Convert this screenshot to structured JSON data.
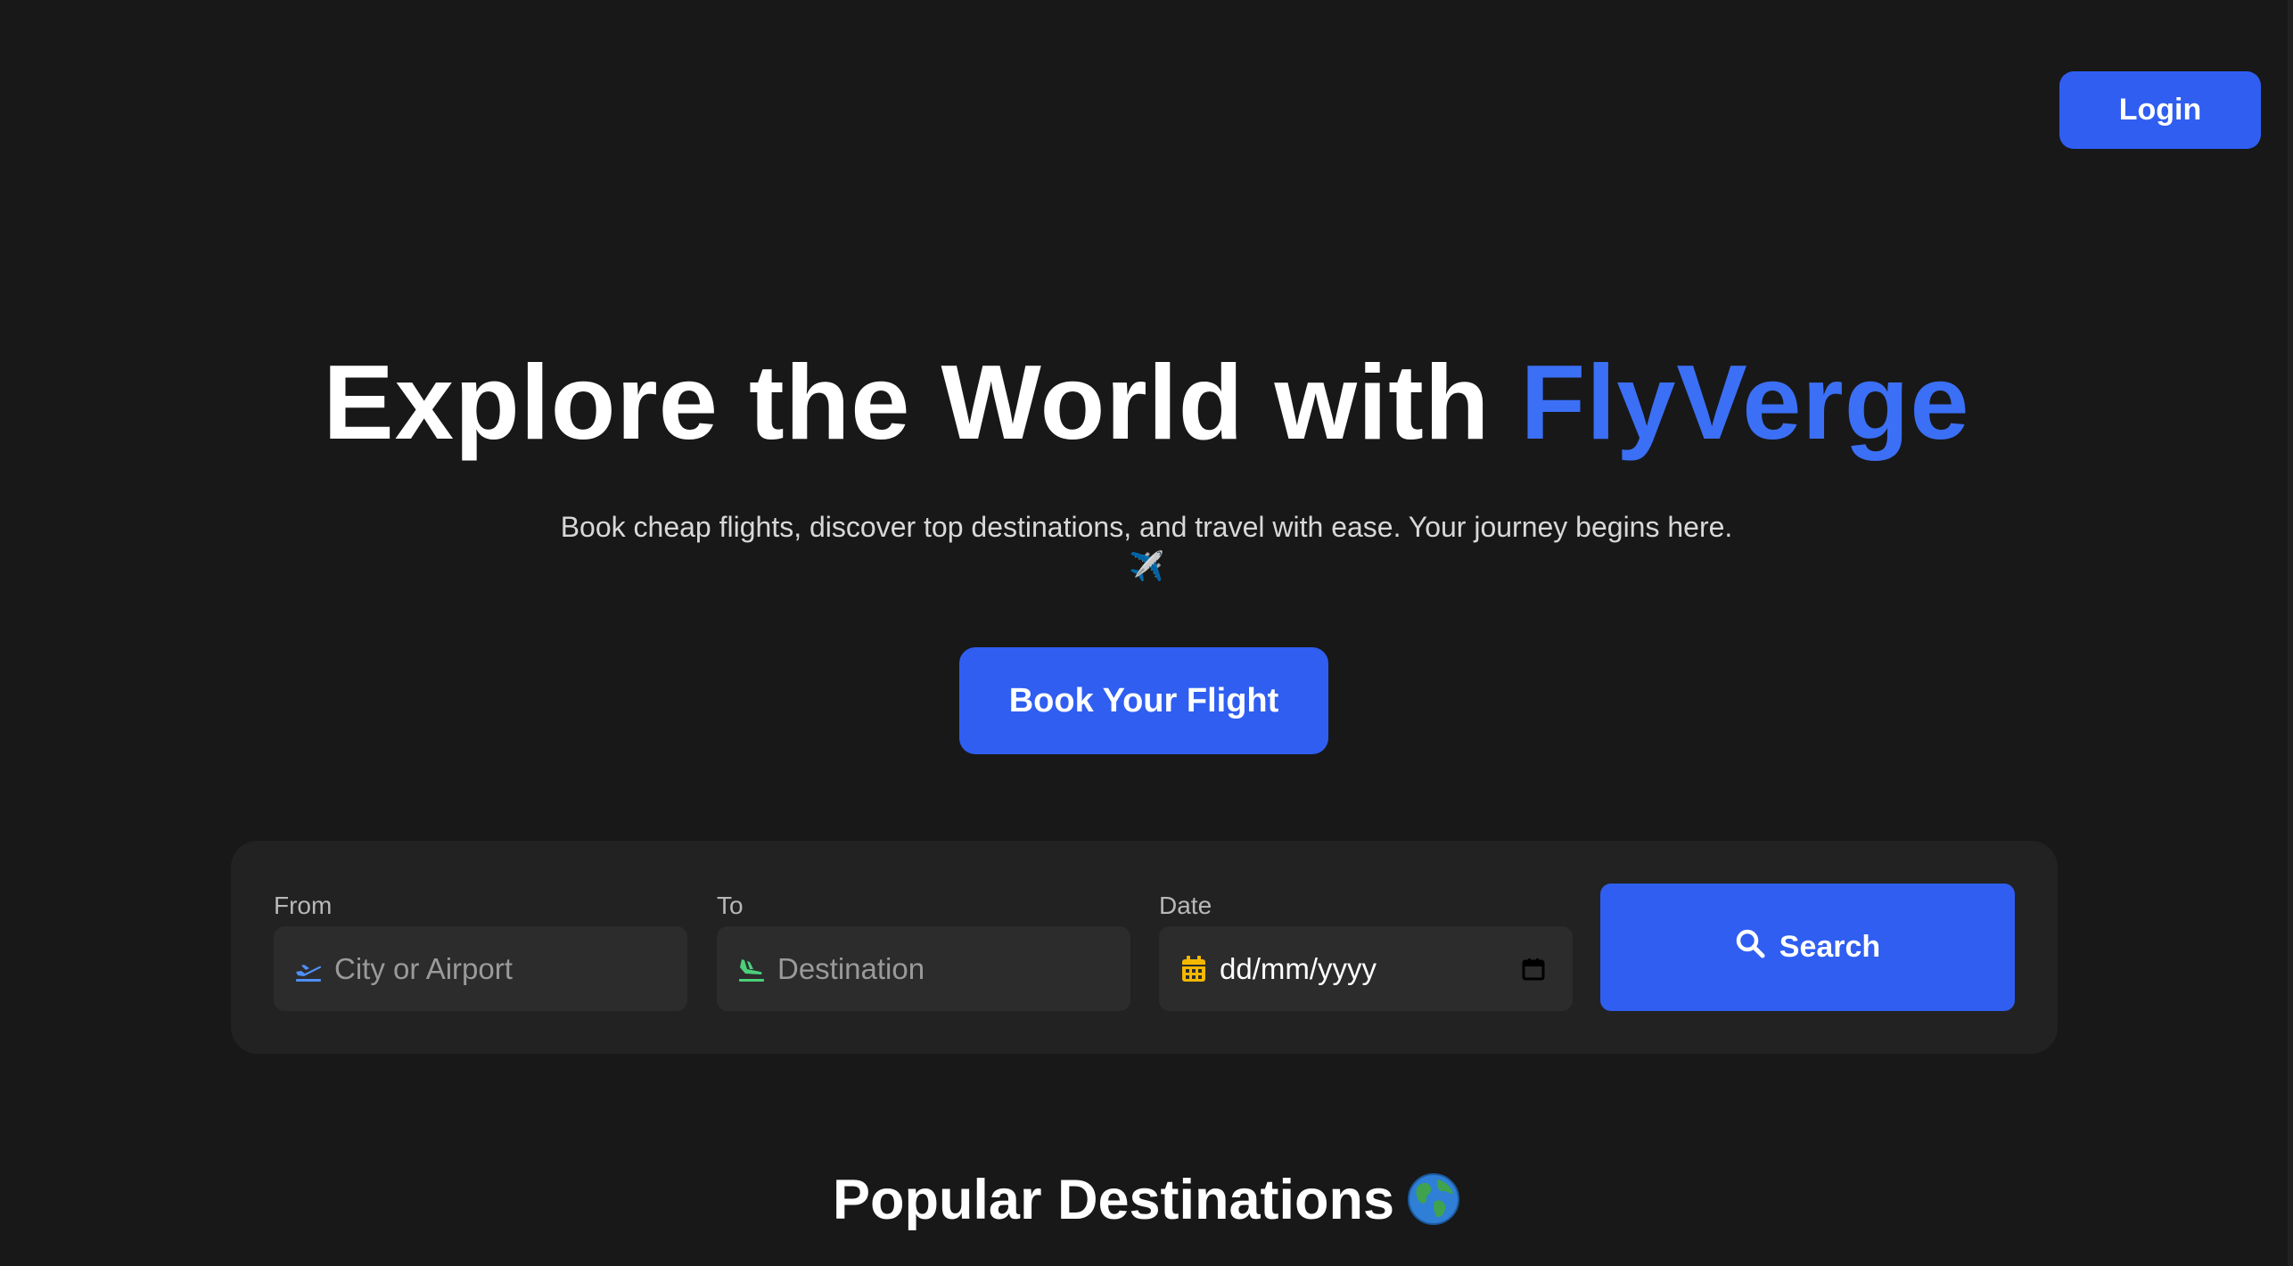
{
  "header": {
    "login_label": "Login"
  },
  "hero": {
    "title_prefix": "Explore the World with ",
    "title_brand": "FlyVerge",
    "subtitle": "Book cheap flights, discover top destinations, and travel with ease. Your journey begins here.",
    "subtitle_emoji": "✈️",
    "cta_label": "Book Your Flight"
  },
  "search": {
    "from": {
      "label": "From",
      "placeholder": "City or Airport",
      "icon": "plane-departure-icon"
    },
    "to": {
      "label": "To",
      "placeholder": "Destination",
      "icon": "plane-arrival-icon"
    },
    "date": {
      "label": "Date",
      "value": "dd/mm/yyyy",
      "icon": "calendar-icon"
    },
    "button_label": "Search"
  },
  "sections": {
    "popular_title": "Popular Destinations"
  },
  "colors": {
    "background": "#181818",
    "accent": "#2f5ef1",
    "brand_text": "#3b6ff5",
    "panel": "#222222",
    "field": "#2c2c2c",
    "from_icon": "#4f8ff7",
    "to_icon": "#4cd07a",
    "date_icon": "#f5b800"
  }
}
